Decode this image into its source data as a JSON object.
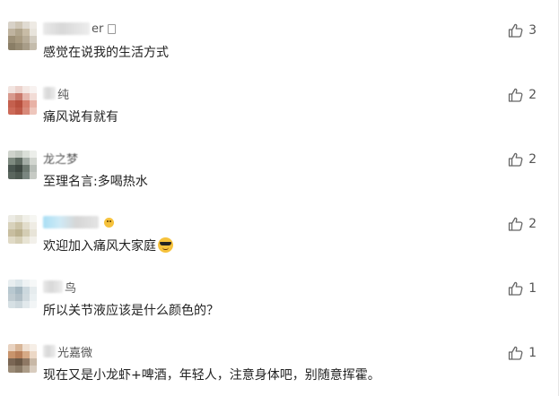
{
  "comments": [
    {
      "name_suffix": "er",
      "text": "感觉在说我的生活方式",
      "likes": "3",
      "avatar_colors": [
        "#d8d2c8",
        "#cfc6b6",
        "#e0dbd2",
        "#eeeae4",
        "#bfb39f",
        "#b0a48c",
        "#c8bca6",
        "#e8e4dc",
        "#9c8f76",
        "#a89a80",
        "#b8ad98",
        "#d2ccc0",
        "#8a7e66",
        "#968a72",
        "#a89d88",
        "#c4bcac"
      ]
    },
    {
      "name_suffix": "纯",
      "text": "痛风说有就有",
      "likes": "2",
      "avatar_colors": [
        "#f2e4e0",
        "#ecd2cc",
        "#f4e8e4",
        "#f8f2f0",
        "#d89a8e",
        "#c97a6c",
        "#e6b8ae",
        "#f2dcd6",
        "#c4604e",
        "#b8503e",
        "#d67e6c",
        "#e8b2a6",
        "#cc6a58",
        "#c05a48",
        "#d88a7a",
        "#eec6bc"
      ]
    },
    {
      "name_suffix": "龙之梦",
      "text": "至理名言:多喝热水",
      "likes": "2",
      "avatar_colors": [
        "#cfd3cc",
        "#c2c8c0",
        "#dadfd8",
        "#eceeea",
        "#7e8a80",
        "#5f6b62",
        "#a4ada6",
        "#d2d6d0",
        "#4a5650",
        "#3c4640",
        "#6c7870",
        "#b8beb8",
        "#5a665e",
        "#4e5a52",
        "#7a8680",
        "#c6cac4"
      ]
    },
    {
      "name_suffix": "",
      "text": "欢迎加入痛风大家庭",
      "likes": "2",
      "avatar_colors": [
        "#ecebe4",
        "#e4e2d6",
        "#f0efe8",
        "#f6f6f2",
        "#d8d2bc",
        "#ccc4a8",
        "#e2ddcc",
        "#efece4",
        "#c8bea0",
        "#bcb290",
        "#d4cdb4",
        "#e8e4d8",
        "#e0dac6",
        "#d6cfb6",
        "#e8e4d4",
        "#f2f0ea"
      ]
    },
    {
      "name_suffix": "鸟",
      "text": "所以关节液应该是什么颜色的？",
      "likes": "1",
      "avatar_colors": [
        "#e8eef0",
        "#dce6ea",
        "#eef2f4",
        "#f6f8f8",
        "#b8c8d0",
        "#a6b8c2",
        "#ccd8de",
        "#e6ecee",
        "#c0ccd2",
        "#b2c0c8",
        "#d0dadf",
        "#eaf0f2",
        "#d6e0e4",
        "#cdd8dd",
        "#e2e9ec",
        "#f2f5f6"
      ]
    },
    {
      "name_suffix": "光嘉微",
      "text": "现在又是小龙虾+啤酒，年轻人，注意身体吧，别随意挥霍。",
      "likes": "1",
      "avatar_colors": [
        "#e8d2c0",
        "#d8b698",
        "#efe0d2",
        "#f6eee6",
        "#c8946c",
        "#b8805a",
        "#d6aa86",
        "#ecd8c6",
        "#7a6654",
        "#6a5846",
        "#8e7864",
        "#c8b8a6",
        "#9a8a76",
        "#8a7a66",
        "#ac9c88",
        "#d8ccbe"
      ]
    }
  ]
}
